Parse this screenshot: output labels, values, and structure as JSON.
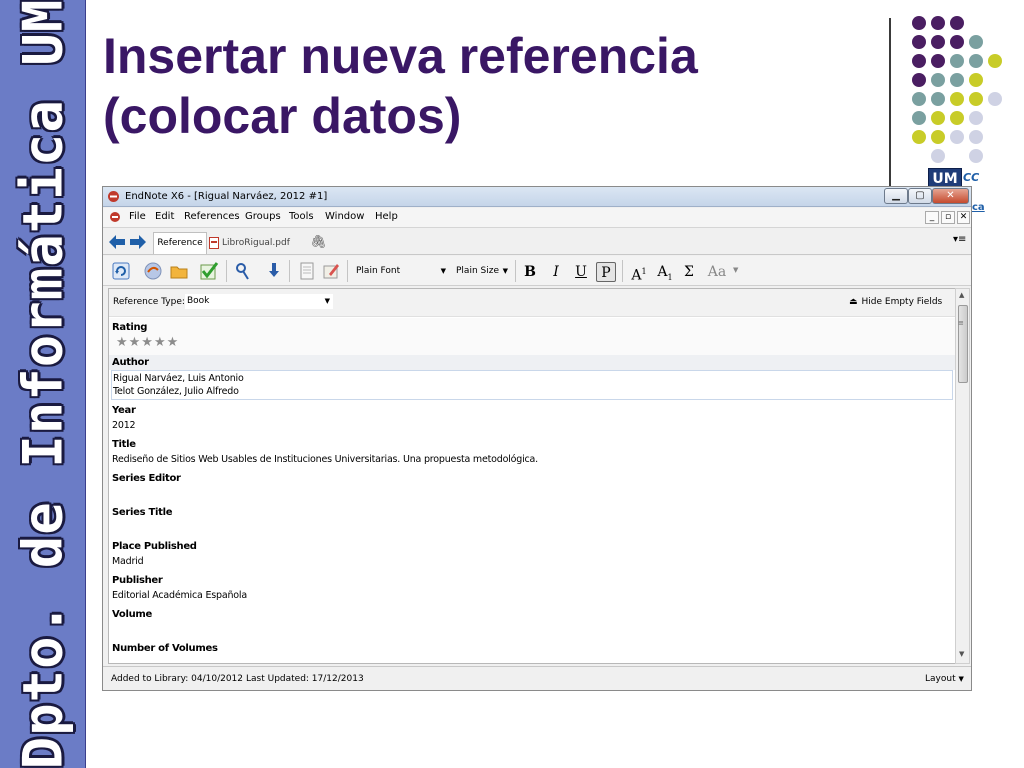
{
  "slide": {
    "banner_text": "Dpto. de Informática UM",
    "title_line1": "Insertar nueva referencia",
    "title_line2": "(colocar datos)",
    "logo_um": "UM",
    "logo_cc": "CC",
    "logo_ca": "ca"
  },
  "colors": {
    "title": "#3a1765",
    "banner": "#6b7cc6",
    "dot_purple": "#4a1e62",
    "dot_teal": "#7aa0a0",
    "dot_yellow": "#c8cc28",
    "dot_lilac": "#cfd2e4"
  },
  "window": {
    "title": "EndNote X6 - [Rigual Narváez, 2012 #1]",
    "min_label": "▁",
    "max_label": "▢",
    "close_label": "✕"
  },
  "menu": {
    "items": [
      "File",
      "Edit",
      "References",
      "Groups",
      "Tools",
      "Window",
      "Help"
    ],
    "inner_min": "_",
    "inner_max": "▫",
    "inner_close": "✕"
  },
  "tabs": {
    "reference": "Reference",
    "pdf": "LibroRigual.pdf",
    "menu_glyph": "▾≡"
  },
  "toolbar": {
    "font": "Plain Font",
    "size": "Plain Size",
    "bold": "B",
    "italic": "I",
    "underline": "U",
    "plain": "P",
    "superscript": "A",
    "superscript_mark": "1",
    "subscript": "A",
    "subscript_mark": "1",
    "symbol": "Σ",
    "case": "Aa"
  },
  "reference": {
    "type_label": "Reference Type:",
    "type_value": "Book",
    "hide_empty": "Hide Empty Fields",
    "fields": {
      "rating_label": "Rating",
      "rating_stars": "★★★★★",
      "rating_value": 0,
      "author_label": "Author",
      "author_1": "Rigual Narváez, Luis Antonio",
      "author_2": "Telot González, Julio Alfredo",
      "year_label": "Year",
      "year_value": "2012",
      "title_label": "Title",
      "title_value": "Rediseño de Sitios Web Usables de Instituciones Universitarias. Una propuesta metodológica.",
      "series_editor_label": "Series Editor",
      "series_title_label": "Series Title",
      "place_label": "Place Published",
      "place_value": "Madrid",
      "publisher_label": "Publisher",
      "publisher_value": "Editorial Académica Española",
      "volume_label": "Volume",
      "num_volumes_label": "Number of Volumes"
    }
  },
  "status": {
    "added": "Added to Library: 04/10/2012",
    "updated": "Last Updated: 17/12/2013",
    "layout": "Layout"
  }
}
